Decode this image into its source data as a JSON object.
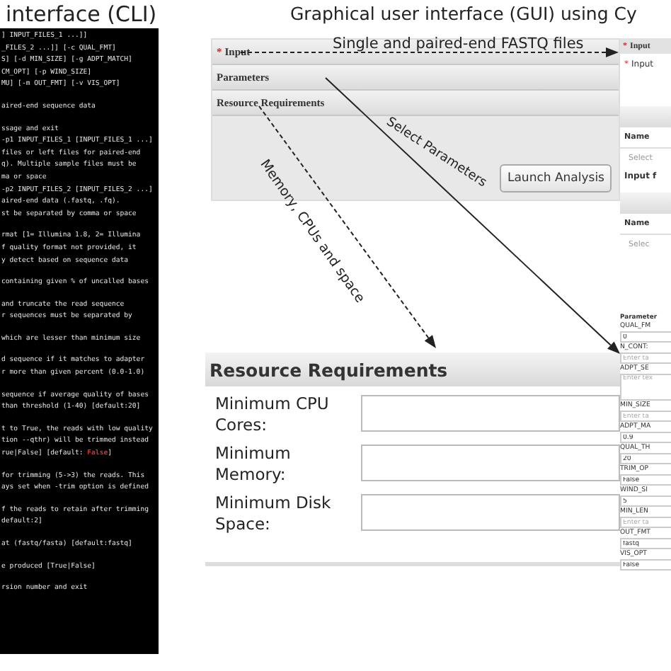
{
  "cli": {
    "title": "interface (CLI)",
    "blocks": [
      {
        "lines": [
          "] INPUT_FILES_1 ...]]",
          "_FILES_2 ...]] [-c QUAL_FMT]",
          "S] [-d MIN_SIZE] [-g ADPT_MATCH]",
          "CM_OPT] [-p WIND_SIZE]",
          "MU] [-m OUT_FMT] [-v VIS_OPT]"
        ]
      },
      {
        "lines": [
          "aired-end sequence data"
        ]
      },
      {
        "lines": [
          "ssage and exit",
          "-p1 INPUT_FILES_1 [INPUT_FILES_1 ...]",
          "files or left files for paired-end",
          "q). Multiple sample files must be",
          "ma or space",
          "-p2 INPUT_FILES_2 [INPUT_FILES_2 ...]",
          "aired-end data (.fastq, .fq).",
          "st be separated by comma or space"
        ]
      },
      {
        "lines": [
          "rmat [1= Illumina 1.8, 2= Illumina",
          "f quality format not provided, it",
          "y detect based on sequence data"
        ]
      },
      {
        "lines": [
          "containing given % of uncalled bases"
        ]
      },
      {
        "lines": [
          "and truncate the read sequence",
          "r sequences must be separated by"
        ]
      },
      {
        "lines": [
          "which are lesser than minimum size"
        ]
      },
      {
        "lines": [
          "d sequence if it matches to adapter",
          "r more than given percent (0.0-1.0)"
        ]
      },
      {
        "lines": [
          "sequence if average quality of bases",
          "than threshold (1-40) [default:20]"
        ]
      },
      {
        "lines": [
          "t to True, the reads with low quality",
          "tion --qthr) will be trimmed instead",
          {
            "parts": [
              {
                "text": "rue|False] [default: "
              },
              {
                "text": "False",
                "color": "#e03030"
              },
              {
                "text": "]"
              }
            ]
          }
        ]
      },
      {
        "lines": [
          "for trimming (5->3) the reads. This",
          "ays set when -trim option is defined"
        ]
      },
      {
        "lines": [
          "f the reads to retain after trimming",
          "default:2]"
        ]
      },
      {
        "lines": [
          "at (fastq/fasta) [default:fastq]"
        ]
      },
      {
        "lines": [
          "e produced [True|False]"
        ]
      },
      {
        "lines": [
          "rsion number and exit"
        ]
      }
    ]
  },
  "gui": {
    "title": "Graphical user interface (GUI) using Cy",
    "accordion": {
      "sections": [
        {
          "label": "Input",
          "asterisk": "*"
        },
        {
          "label": "Parameters"
        },
        {
          "label": "Resource Requirements"
        }
      ],
      "button": "Launch Analysis"
    },
    "annotations": [
      {
        "kind": "dashed",
        "text": "Single and paired-end FASTQ files"
      },
      {
        "kind": "solid",
        "text": "Select Parameters"
      },
      {
        "kind": "dashed",
        "text": "Memory, CPUs and space"
      }
    ],
    "resource_panel": {
      "title": "Resource Requirements",
      "fields": [
        {
          "label": "Minimum CPU Cores:"
        },
        {
          "label": "Minimum Memory:"
        },
        {
          "label": "Minimum Disk Space:"
        }
      ]
    },
    "right_panel": {
      "header": {
        "label": "Input",
        "asterisk": "*"
      },
      "input_label": {
        "label": "Input",
        "asterisk": "*"
      },
      "tables": [
        {
          "column": "Name",
          "placeholder": "Select"
        },
        {
          "column": "Name",
          "placeholder": "Selec"
        }
      ],
      "note": "Input f",
      "params_title": "Parameter",
      "params": [
        {
          "kind": "input",
          "label": "QUAL_FM",
          "value": "0"
        },
        {
          "kind": "input",
          "label": "N_CONT:",
          "placeholder": "Enter ta"
        },
        {
          "kind": "textarea",
          "label": "ADPT_SE",
          "placeholder": "Enter tex"
        },
        {
          "kind": "input",
          "label": "MIN_SIZE",
          "placeholder": "Enter ta"
        },
        {
          "kind": "input",
          "label": "ADPT_MA",
          "value": "0.9"
        },
        {
          "kind": "input",
          "label": "QUAL_TH",
          "value": "20"
        },
        {
          "kind": "input",
          "label": "TRIM_OP",
          "value": "False"
        },
        {
          "kind": "input",
          "label": "WIND_SI",
          "value": "5"
        },
        {
          "kind": "input",
          "label": "MIN_LEN",
          "placeholder": "Enter ta"
        },
        {
          "kind": "input",
          "label": "OUT_FMT",
          "value": "fastq"
        },
        {
          "kind": "input",
          "label": "VIS_OPT",
          "value": "False"
        }
      ]
    }
  }
}
